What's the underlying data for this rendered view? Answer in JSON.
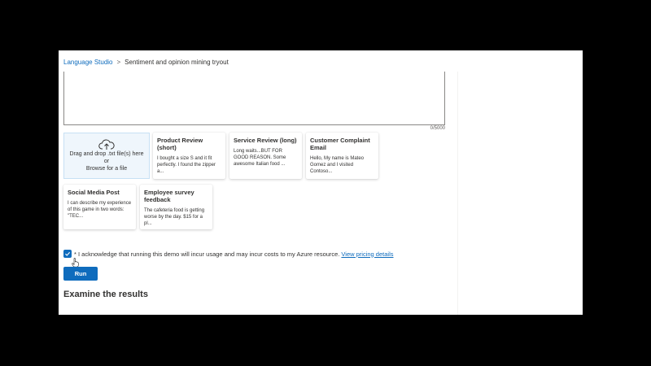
{
  "breadcrumb": {
    "root": "Language Studio",
    "separator": ">",
    "current": "Sentiment and opinion mining tryout"
  },
  "input": {
    "char_count": "0/5000"
  },
  "upload": {
    "icon": "cloud-upload-icon",
    "line1": "Drag and drop .txt file(s) here",
    "line2": "or",
    "line3": "Browse for a file"
  },
  "samples": [
    {
      "title": "Product Review (short)",
      "text": "I bought a size S and it fit perfectly. I found the zipper a..."
    },
    {
      "title": "Service Review (long)",
      "text": "Long waits...BUT FOR GOOD REASON. Some awesome Italian food ..."
    },
    {
      "title": "Customer Complaint Email",
      "text": "Hello, My name is Mateo Gomez and I visited Contoso..."
    },
    {
      "title": "Social Media Post",
      "text": "I can describe my experience of this game in two words: \"TEC..."
    },
    {
      "title": "Employee survey feedback",
      "text": "The cafeteria food is getting worse by the day. $15 for a pl..."
    }
  ],
  "acknowledge": {
    "checked": true,
    "text": "* I acknowledge that running this demo will incur usage and may incur costs to my Azure resource.",
    "link": "View pricing details"
  },
  "run_label": "Run",
  "results_heading": "Examine the results",
  "colors": {
    "accent": "#0f6cbd",
    "upload_bg": "#eff6fc"
  }
}
